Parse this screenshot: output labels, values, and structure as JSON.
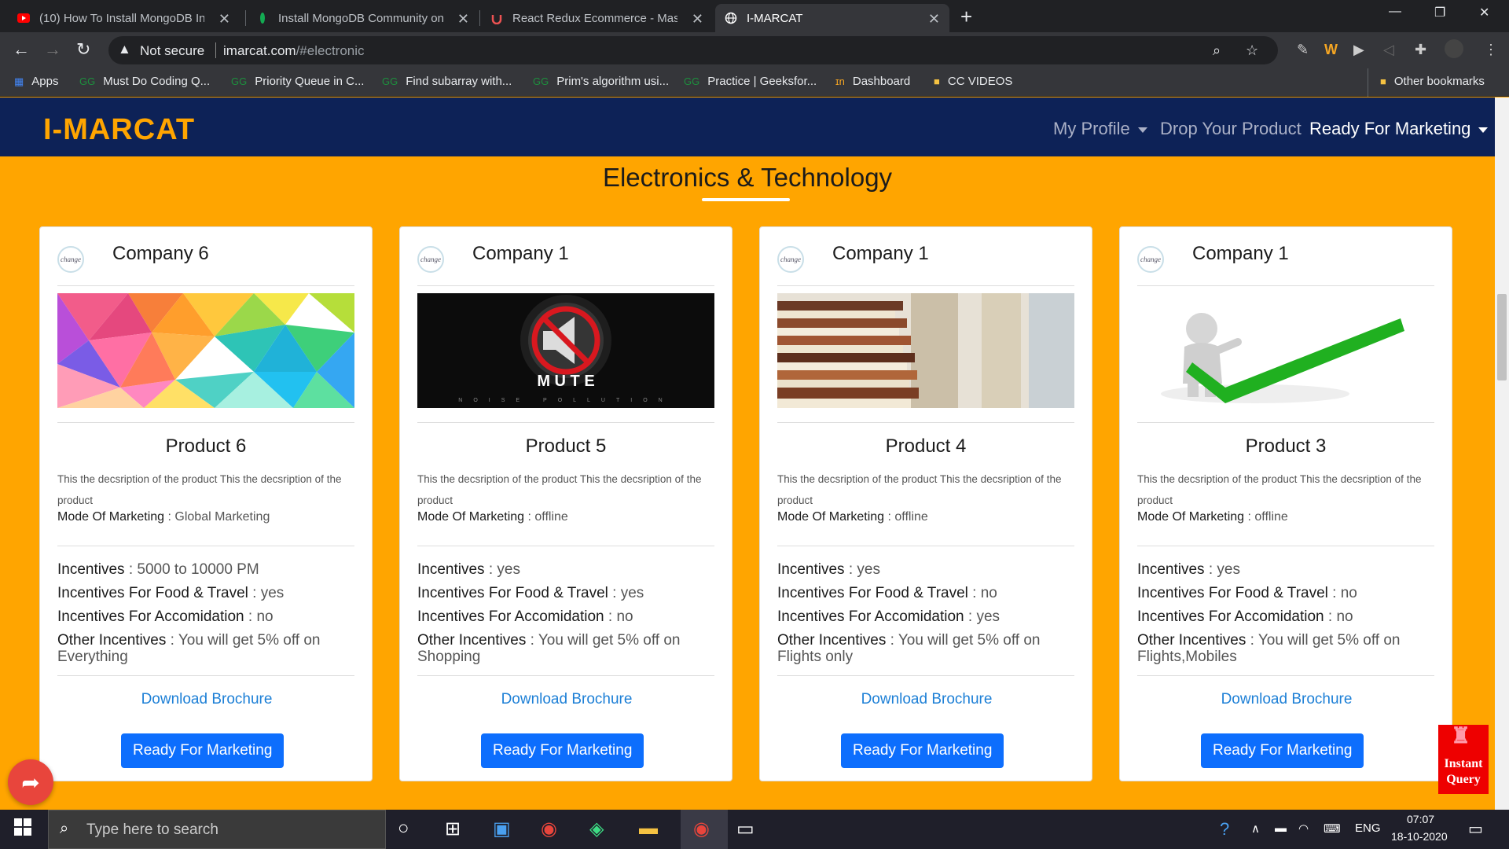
{
  "browser": {
    "tabs": [
      {
        "title": "(10) How To Install MongoDB In",
        "icon": "youtube-icon"
      },
      {
        "title": "Install MongoDB Community on",
        "icon": "mongodb-leaf-icon"
      },
      {
        "title": "React Redux Ecommerce - Maste",
        "icon": "udemy-icon"
      },
      {
        "title": "I-MARCAT",
        "icon": "globe-icon"
      }
    ],
    "security": "Not secure",
    "url_host": "imarcat.com",
    "url_path": "/#electronic",
    "bookmarks": [
      "Apps",
      "Must Do Coding Q...",
      "Priority Queue in C...",
      "Find subarray with...",
      "Prim's algorithm usi...",
      "Practice | Geeksfor...",
      "Dashboard",
      "CC VIDEOS"
    ],
    "other_bookmarks": "Other bookmarks"
  },
  "site": {
    "brand": "I-MARCAT",
    "nav": {
      "profile": "My Profile",
      "drop": "Drop Your Product",
      "ready": "Ready For Marketing"
    },
    "heading": "Electronics & Technology",
    "labels": {
      "mode": "Mode Of Marketing",
      "incentives": "Incentives",
      "food": "Incentives For Food & Travel",
      "accom": "Incentives For Accomidation",
      "other": "Other Incentives",
      "download": "Download Brochure",
      "button": "Ready For Marketing",
      "logo": "change"
    },
    "cards": [
      {
        "company": "Company 6",
        "product": "Product 6",
        "desc": "This the decsription of the product This the decsription of the product",
        "mode": " : Global Marketing",
        "inc": " : 5000 to 10000 PM",
        "food": " : yes",
        "accom": " : no",
        "other": " : You will get 5% off on Everything"
      },
      {
        "company": "Company 1",
        "product": "Product 5",
        "desc": "This the decsription of the product This the decsription of the product",
        "mode": " : offline",
        "inc": " : yes",
        "food": " : yes",
        "accom": " : no",
        "other": " : You will get 5% off on Shopping"
      },
      {
        "company": "Company 1",
        "product": "Product 4",
        "desc": "This the decsription of the product This the decsription of the product",
        "mode": " : offline",
        "inc": " : yes",
        "food": " : no",
        "accom": " : yes",
        "other": " : You will get 5% off on Flights only"
      },
      {
        "company": "Company 1",
        "product": "Product 3",
        "desc": "This the decsription of the product This the decsription of the product",
        "mode": " : offline",
        "inc": " : yes",
        "food": " : no",
        "accom": " : no",
        "other": " : You will get 5% off on Flights,Mobiles"
      }
    ],
    "instant_query": "Instant Query",
    "mute_text": "M U T E",
    "mute_sub": "NOISE POLLUTION"
  },
  "taskbar": {
    "search": "Type here to search",
    "lang": "ENG",
    "time": "07:07",
    "date": "18-10-2020"
  }
}
